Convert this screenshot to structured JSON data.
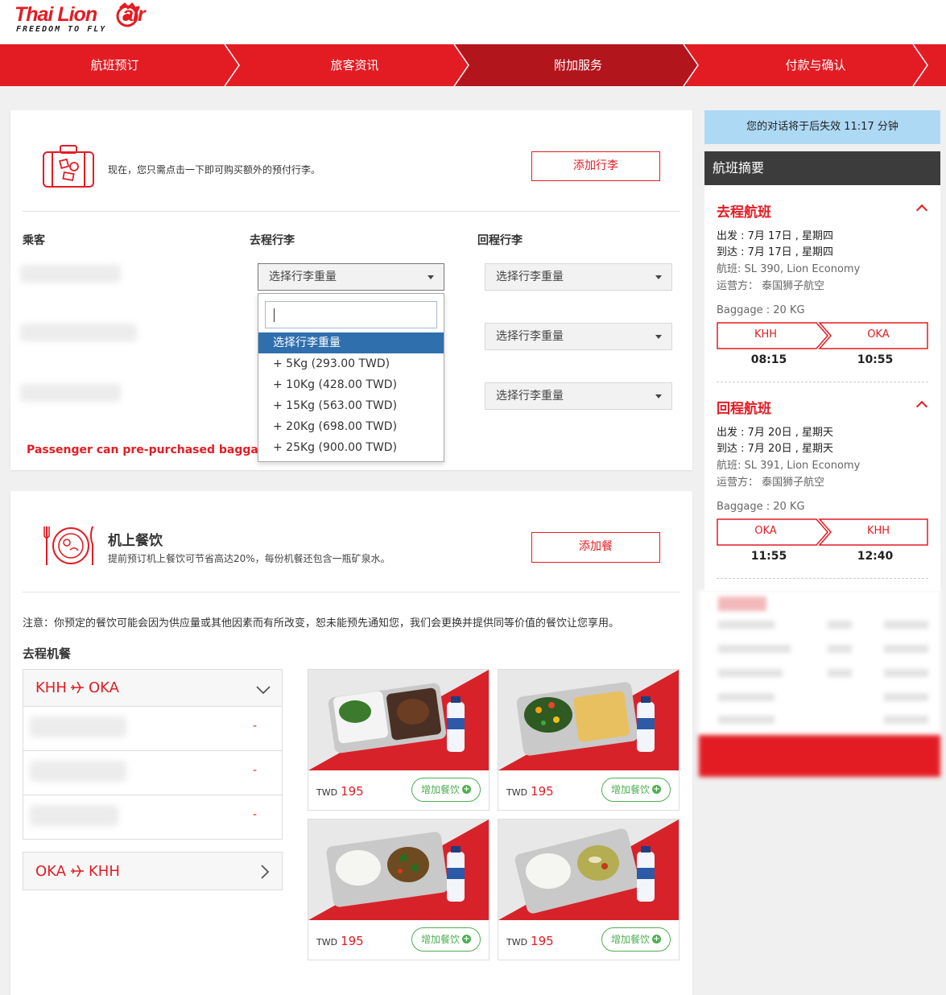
{
  "header": {
    "logo_text": "Thai Lion",
    "logo_suffix": "air",
    "tagline": "FREEDOM TO FLY"
  },
  "steps": [
    {
      "label": "航班预订"
    },
    {
      "label": "旅客资讯"
    },
    {
      "label": "附加服务"
    },
    {
      "label": "付款与确认"
    }
  ],
  "baggage": {
    "intro": "现在，您只需点击一下即可购买额外的预付行李。",
    "add_button": "添加行李",
    "col_passenger": "乘客",
    "col_outbound": "去程行李",
    "col_return": "回程行李",
    "select_placeholder": "选择行李重量",
    "dropdown": {
      "options": [
        "选择行李重量",
        "+ 5Kg (293.00 TWD)",
        "+ 10Kg (428.00 TWD)",
        "+ 15Kg (563.00 TWD)",
        "+ 20Kg (698.00 TWD)",
        "+ 25Kg (900.00 TWD)"
      ]
    },
    "warning": "Passenger can pre-purchased baggage no"
  },
  "meals": {
    "title": "机上餐饮",
    "subtitle": "提前预订机上餐饮可节省高达20%，每份机餐还包含一瓶矿泉水。",
    "add_button": "添加餐",
    "note": "注意：你预定的餐饮可能会因为供应量或其他因素而有所改变，恕未能预先通知您，我们会更换并提供同等价值的餐饮让您享用。",
    "section_heading": "去程机餐",
    "routes": [
      {
        "from": "KHH",
        "to": "OKA"
      },
      {
        "from": "OKA",
        "to": "KHH"
      }
    ],
    "dash": "-",
    "items": [
      {
        "currency": "TWD",
        "price": "195",
        "add_label": "增加餐饮"
      },
      {
        "currency": "TWD",
        "price": "195",
        "add_label": "增加餐饮"
      },
      {
        "currency": "TWD",
        "price": "195",
        "add_label": "增加餐饮"
      },
      {
        "currency": "TWD",
        "price": "195",
        "add_label": "增加餐饮"
      }
    ]
  },
  "sidebar": {
    "timer": "您的对话将于后失效 11:17 分钟",
    "summary_title": "航班摘要",
    "outbound": {
      "title": "去程航班",
      "depart": "出发 : 7月 17日 , 星期四",
      "arrive": "到达 : 7月 17日 , 星期四",
      "flight": "航班: SL 390, Lion Economy",
      "operator": "运营方： 泰国狮子航空",
      "baggage": "Baggage : 20 KG",
      "from": "KHH",
      "to": "OKA",
      "dep_time": "08:15",
      "arr_time": "10:55"
    },
    "return": {
      "title": "回程航班",
      "depart": "出发 : 7月 20日 , 星期天",
      "arrive": "到达 : 7月 20日 , 星期天",
      "flight": "航班: SL 391, Lion Economy",
      "operator": "运营方： 泰国狮子航空",
      "baggage": "Baggage : 20 KG",
      "from": "OKA",
      "to": "KHH",
      "dep_time": "11:55",
      "arr_time": "12:40"
    }
  },
  "colors": {
    "brand_red": "#e31c23",
    "active_step": "#b3151c",
    "timer_bg": "#aed9f5",
    "summary_head": "#3c3c3c",
    "add_meal_green": "#4caf50",
    "dropdown_selected": "#2f6fae"
  }
}
